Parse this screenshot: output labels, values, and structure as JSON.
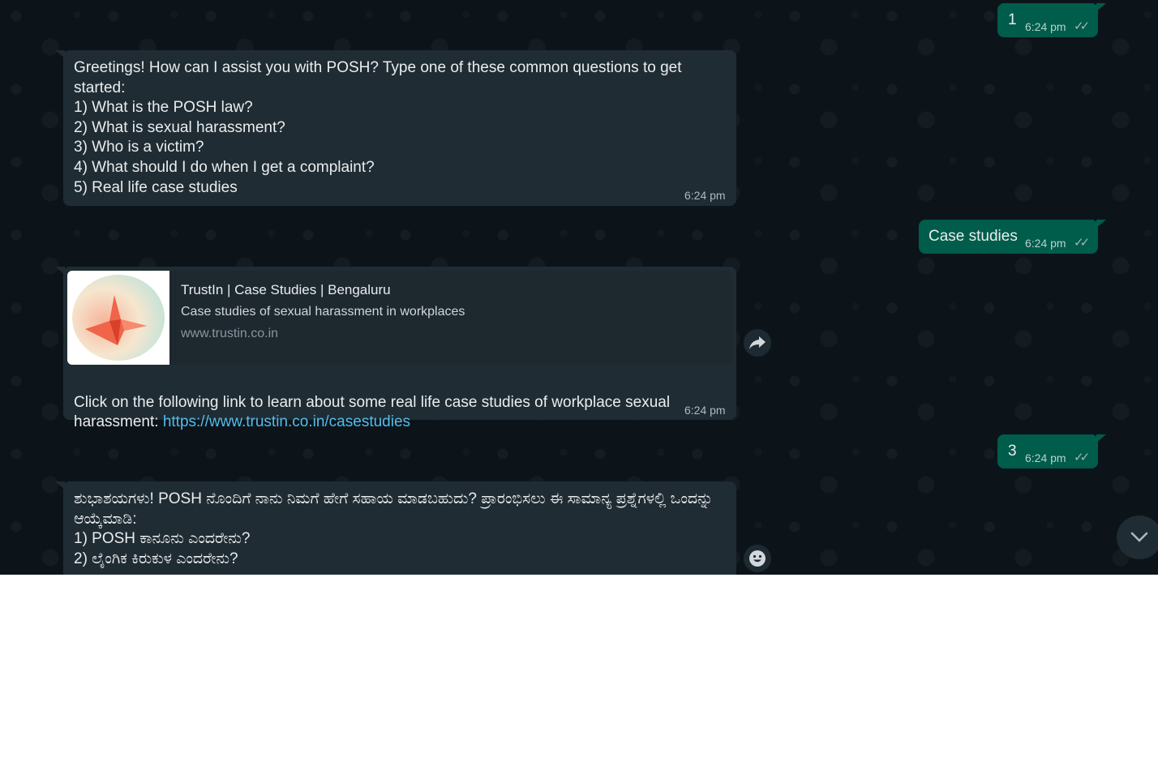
{
  "messages": {
    "out1": {
      "text": "1",
      "time": "6:24 pm"
    },
    "in1": {
      "text": "Greetings! How can I assist you with POSH?  Type one of these common questions to get started:\n1) What is the POSH law?\n2) What is sexual harassment?\n3) Who is a victim?\n4) What should I do when I get a complaint?\n5) Real life case studies",
      "time": "6:24 pm"
    },
    "out2": {
      "text": "Case studies",
      "time": "6:24 pm"
    },
    "in2": {
      "preview_title": "TrustIn | Case Studies | Bengaluru",
      "preview_desc": "Case studies of sexual harassment in workplaces",
      "preview_url": "www.trustin.co.in",
      "text_before_link": "Click on the following link to learn about some real life case studies of workplace sexual harassment: ",
      "link": "https://www.trustin.co.in/casestudies",
      "time": "6:24 pm"
    },
    "out3": {
      "text": "3",
      "time": "6:24 pm"
    },
    "in3": {
      "text": "ಶುಭಾಶಯಗಳು! POSH ನೊಂದಿಗೆ ನಾನು ನಿಮಗೆ ಹೇಗೆ ಸಹಾಯ ಮಾಡಬಹುದು? ಪ್ರಾರಂಭಿಸಲು ಈ ಸಾಮಾನ್ಯ ಪ್ರಶ್ನೆಗಳಲ್ಲಿ ಒಂದನ್ನು ಆಯ್ಕೆಮಾಡಿ:\n1) POSH ಕಾನೂನು ಎಂದರೇನು?\n2) ಲೈಂಗಿಕ ಕಿರುಕುಳ ಎಂದರೇನು?"
    }
  },
  "icons": {
    "forward": "forward-icon",
    "emoji": "emoji-icon",
    "scroll_down": "chevron-down-icon",
    "read_receipt": "double-check-icon"
  },
  "colors": {
    "chat_bg": "#0c141a",
    "incoming_bubble": "#202c33",
    "outgoing_bubble": "#005c4b",
    "link": "#53bdeb"
  }
}
